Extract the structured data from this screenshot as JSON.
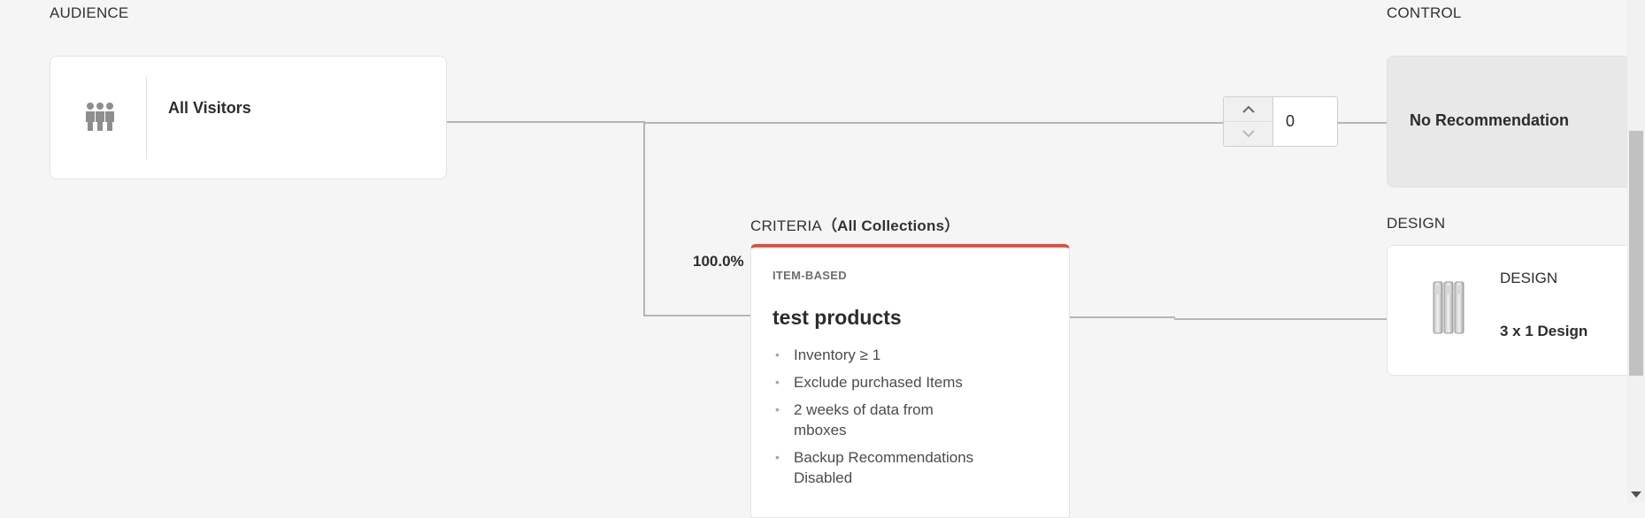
{
  "sections": {
    "audience": "AUDIENCE",
    "control": "CONTROL",
    "criteria": "CRITERIA",
    "criteria_collection": "（All Collections）",
    "design": "DESIGN"
  },
  "audience": {
    "name": "All Visitors",
    "icon": "people-group-icon"
  },
  "control_stepper": {
    "value": "0"
  },
  "control_card": {
    "label": "No Recommendation"
  },
  "criteria_card": {
    "percentage": "100.0%",
    "type": "ITEM-BASED",
    "name": "test products",
    "rules": [
      "Inventory ≥ 1",
      "Exclude purchased Items",
      "2 weeks of data from mboxes",
      "Backup Recommendations Disabled"
    ]
  },
  "design_card": {
    "title": "DESIGN",
    "subtitle": "3 x 1 Design",
    "icon": "design-thumbnail-icon"
  },
  "colors": {
    "background": "#f5f5f5",
    "criteria_accent": "#d3574b",
    "control_card_bg": "#e8e8e8",
    "connector": "#b5b5b5"
  }
}
